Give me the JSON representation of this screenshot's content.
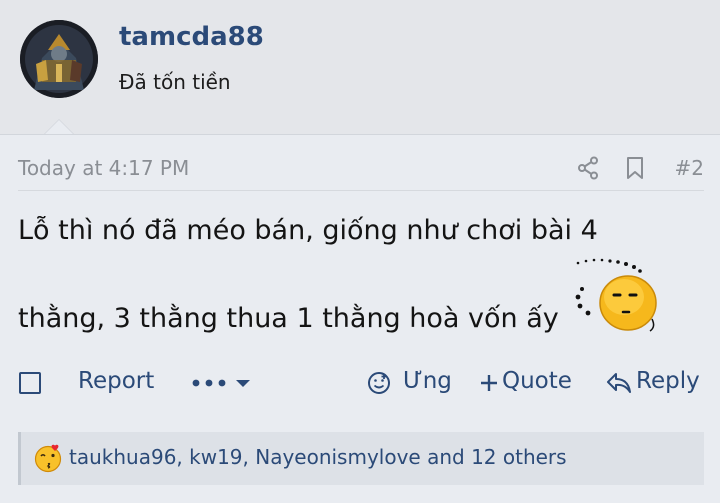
{
  "user": {
    "name": "tamcda88",
    "title": "Đã tốn tiền"
  },
  "post": {
    "timestamp": "Today at 4:17 PM",
    "number": "#2",
    "lines": [
      "Lỗ thì nó đã méo bán, giống như chơi bài 4",
      "thằng, 3 thằng thua 1 thằng hoà vốn ấy"
    ]
  },
  "actions": {
    "report": "Report",
    "react": "Ưng",
    "quote": "Quote",
    "reply": "Reply"
  },
  "reactions": {
    "summary": "taukhua96, kw19, Nayeonismylove and 12 others"
  },
  "icons": {
    "share": "share-icon",
    "bookmark": "bookmark-icon",
    "more": "more-dots-icon",
    "react": "smiley-react-icon",
    "quote": "plus-icon",
    "reply": "reply-arrow-icon",
    "reaction": "kiss-emoji-icon",
    "inline_emoji": "sleepy-smiley-icon"
  },
  "colors": {
    "accent": "#2b4a78",
    "muted": "#8a8e94",
    "background": "#e9ecf1",
    "header": "#e4e6ea"
  }
}
